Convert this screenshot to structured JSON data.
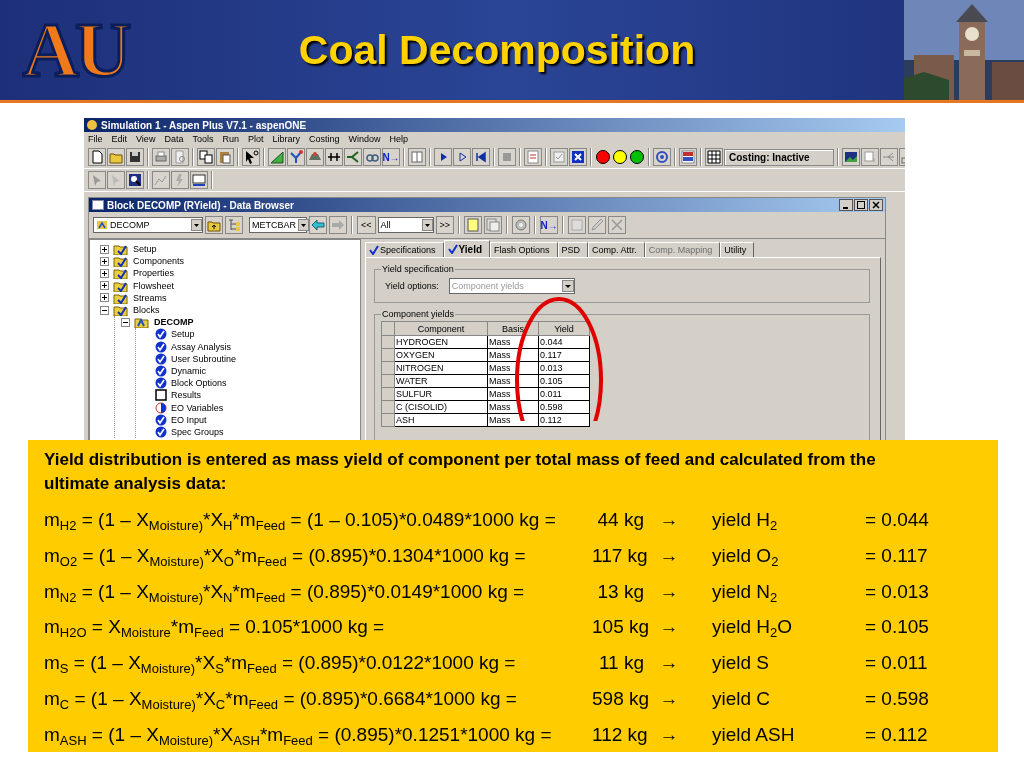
{
  "slide": {
    "logo": "AU",
    "title": "Coal Decomposition"
  },
  "app": {
    "title": "Simulation 1 - Aspen Plus V7.1 - aspenONE",
    "menu": [
      "File",
      "Edit",
      "View",
      "Data",
      "Tools",
      "Run",
      "Plot",
      "Library",
      "Costing",
      "Window",
      "Help"
    ],
    "next_button": "N→",
    "run_lights": [
      {
        "color": "#ff0000"
      },
      {
        "color": "#ffff00"
      },
      {
        "color": "#00c000"
      }
    ],
    "costing_status": "Costing: Inactive"
  },
  "browser": {
    "title": "Block DECOMP (RYield) - Data Browser",
    "object_select": "DECOMP",
    "units_select": "METCBAR",
    "back_button": "<<",
    "filter_select": "All",
    "forward_button": ">>",
    "next_button": "N→",
    "tree": [
      {
        "label": "Setup",
        "kind": "folder",
        "complete": true,
        "partial": false,
        "expanded": false
      },
      {
        "label": "Components",
        "kind": "folder",
        "complete": true,
        "partial": false,
        "expanded": false
      },
      {
        "label": "Properties",
        "kind": "folder",
        "complete": true,
        "partial": false,
        "expanded": false
      },
      {
        "label": "Flowsheet",
        "kind": "folder",
        "complete": true,
        "partial": false,
        "expanded": false
      },
      {
        "label": "Streams",
        "kind": "folder",
        "complete": true,
        "partial": false,
        "expanded": false
      },
      {
        "label": "Blocks",
        "kind": "folder",
        "complete": true,
        "partial": false,
        "expanded": true,
        "children": [
          {
            "label": "DECOMP",
            "kind": "block",
            "complete": true,
            "partial": false,
            "expanded": true,
            "children": [
              {
                "label": "Setup",
                "kind": "form",
                "complete": true,
                "partial": false
              },
              {
                "label": "Assay Analysis",
                "kind": "form",
                "complete": true,
                "partial": false
              },
              {
                "label": "User Subroutine",
                "kind": "form",
                "complete": true,
                "partial": false
              },
              {
                "label": "Dynamic",
                "kind": "form",
                "complete": true,
                "partial": false
              },
              {
                "label": "Block Options",
                "kind": "form",
                "complete": true,
                "partial": false
              },
              {
                "label": "Results",
                "kind": "form",
                "complete": false,
                "partial": false
              },
              {
                "label": "EO Variables",
                "kind": "form",
                "complete": false,
                "partial": true
              },
              {
                "label": "EO Input",
                "kind": "form",
                "complete": true,
                "partial": false
              },
              {
                "label": "Spec Groups",
                "kind": "form",
                "complete": true,
                "partial": false
              }
            ]
          }
        ]
      }
    ],
    "tabs": [
      {
        "label": "Specifications",
        "checked": true,
        "selected": false,
        "disabled": false
      },
      {
        "label": "Yield",
        "checked": true,
        "selected": true,
        "disabled": false
      },
      {
        "label": "Flash Options",
        "checked": false,
        "selected": false,
        "disabled": false
      },
      {
        "label": "PSD",
        "checked": false,
        "selected": false,
        "disabled": false
      },
      {
        "label": "Comp. Attr.",
        "checked": false,
        "selected": false,
        "disabled": false
      },
      {
        "label": "Comp. Mapping",
        "checked": false,
        "selected": false,
        "disabled": true
      },
      {
        "label": "Utility",
        "checked": false,
        "selected": false,
        "disabled": false
      }
    ],
    "yield_spec": {
      "title": "Yield specification",
      "options_label": "Yield options:",
      "options_value": "Component yields"
    },
    "component_yields": {
      "title": "Component yields",
      "columns": [
        "Component",
        "Basis",
        "Yield"
      ],
      "rows": [
        {
          "component": "HYDROGEN",
          "basis": "Mass",
          "yield": "0.044"
        },
        {
          "component": "OXYGEN",
          "basis": "Mass",
          "yield": "0.117"
        },
        {
          "component": "NITROGEN",
          "basis": "Mass",
          "yield": "0.013"
        },
        {
          "component": "WATER",
          "basis": "Mass",
          "yield": "0.105"
        },
        {
          "component": "SULFUR",
          "basis": "Mass",
          "yield": "0.011"
        },
        {
          "component": "C (CISOLID)",
          "basis": "Mass",
          "yield": "0.598"
        },
        {
          "component": "ASH",
          "basis": "Mass",
          "yield": "0.112"
        }
      ]
    }
  },
  "note": {
    "intro": "Yield distribution is entered as mass yield of component per total mass of feed and calculated from the ultimate analysis data:",
    "equations": [
      {
        "formula": "m$_{H2}$ = (1 – X$_{Moisture)}$*X$_{H}$*m$_{Feed}$ = (1 – 0.105)*0.0489*1000 kg =",
        "mass": "44 kg",
        "arrow": "→",
        "result": "yield H$_{2}$",
        "value": "= 0.044"
      },
      {
        "formula": "m$_{O2}$ = (1 – X$_{Moisture)}$*X$_{O}$*m$_{Feed}$ = (0.895)*0.1304*1000 kg =",
        "mass": "117 kg",
        "arrow": "→",
        "result": "yield O$_{2}$",
        "value": "= 0.117"
      },
      {
        "formula": "m$_{N2}$ = (1 – X$_{Moisture)}$*X$_{N}$*m$_{Feed}$ = (0.895)*0.0149*1000 kg =",
        "mass": "13 kg",
        "arrow": "→",
        "result": "yield N$_{2}$",
        "value": "= 0.013"
      },
      {
        "formula": "m$_{H2O}$ = X$_{Moisture}$*m$_{Feed}$ = 0.105*1000 kg =",
        "mass": "105 kg",
        "arrow": "→",
        "result": "yield H$_{2}$O",
        "value": "= 0.105"
      },
      {
        "formula": "m$_{S}$ = (1 – X$_{Moisture)}$*X$_{S}$*m$_{Feed}$ = (0.895)*0.0122*1000 kg =",
        "mass": "11 kg",
        "arrow": "→",
        "result": "yield S",
        "value": "= 0.011"
      },
      {
        "formula": "m$_{C}$ = (1 – X$_{Moisture)}$*X$_{C}$*m$_{Feed}$ = (0.895)*0.6684*1000 kg =",
        "mass": "598 kg",
        "arrow": "→",
        "result": "yield C",
        "value": "= 0.598"
      },
      {
        "formula": "m$_{ASH}$ = (1 – X$_{Moisture)}$*X$_{ASH}$*m$_{Feed}$ = (0.895)*0.1251*1000 kg =",
        "mass": "112 kg",
        "arrow": "→",
        "result": "yield ASH",
        "value": "= 0.112"
      }
    ]
  }
}
